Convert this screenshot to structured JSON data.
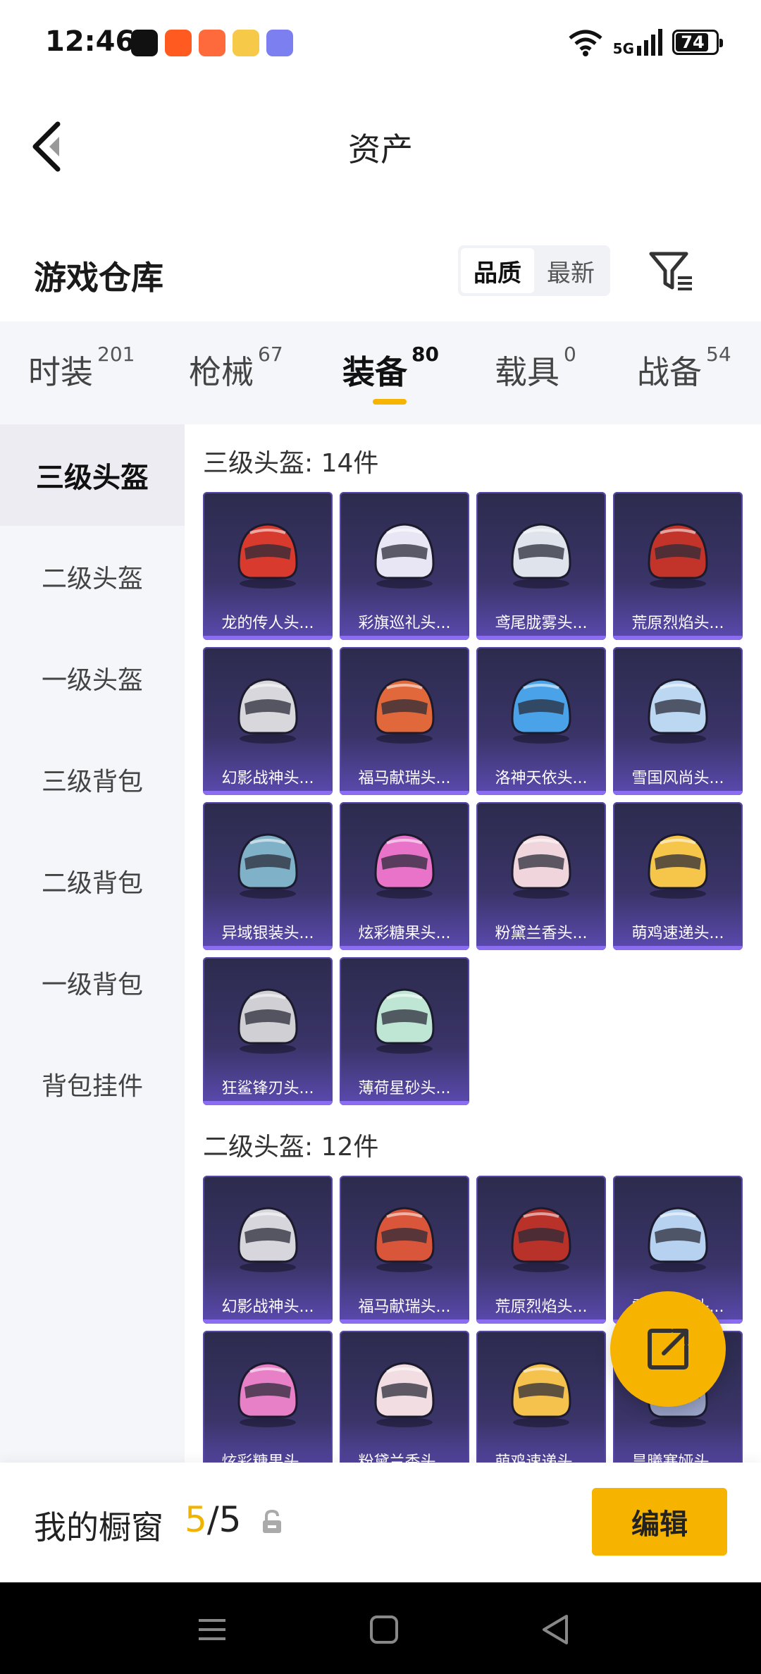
{
  "status_bar": {
    "time": "12:46",
    "network": "5G",
    "battery": "74"
  },
  "nav": {
    "title": "资产"
  },
  "warehouse": {
    "title": "游戏仓库",
    "sort_options": [
      "品质",
      "最新"
    ],
    "active_sort": "品质"
  },
  "categories": [
    {
      "label": "时装",
      "count": "201"
    },
    {
      "label": "枪械",
      "count": "67"
    },
    {
      "label": "装备",
      "count": "80",
      "active": true
    },
    {
      "label": "载具",
      "count": "0"
    },
    {
      "label": "战备",
      "count": "54"
    }
  ],
  "side_nav": [
    "三级头盔",
    "二级头盔",
    "一级头盔",
    "三级背包",
    "二级背包",
    "一级背包",
    "背包挂件"
  ],
  "sections": [
    {
      "title": "三级头盔: 14件",
      "items": [
        {
          "name": "龙的传人头...",
          "color": "#d83a2e"
        },
        {
          "name": "彩旗巡礼头...",
          "color": "#e8e6f4"
        },
        {
          "name": "鸢尾胧雾头...",
          "color": "#dfe3ec"
        },
        {
          "name": "荒原烈焰头...",
          "color": "#c2342a"
        },
        {
          "name": "幻影战神头...",
          "color": "#d8d8dc"
        },
        {
          "name": "福马献瑞头...",
          "color": "#e0683a"
        },
        {
          "name": "洛神天依头...",
          "color": "#4aa3e8"
        },
        {
          "name": "雪国风尚头...",
          "color": "#bcd7f2"
        },
        {
          "name": "异域银装头...",
          "color": "#7fb2c8"
        },
        {
          "name": "炫彩糖果头...",
          "color": "#e873c9"
        },
        {
          "name": "粉黛兰香头...",
          "color": "#f0d6dc"
        },
        {
          "name": "萌鸡速递头...",
          "color": "#f6c64a"
        },
        {
          "name": "狂鲨锋刃头...",
          "color": "#cfcfd4"
        },
        {
          "name": "薄荷星砂头...",
          "color": "#bfe6d4"
        }
      ]
    },
    {
      "title": "二级头盔: 12件",
      "items": [
        {
          "name": "幻影战神头...",
          "color": "#d6d6dc"
        },
        {
          "name": "福马献瑞头...",
          "color": "#d9563a"
        },
        {
          "name": "荒原烈焰头...",
          "color": "#b8322a"
        },
        {
          "name": "雪国风尚头...",
          "color": "#b7d2f0"
        },
        {
          "name": "炫彩糖果头...",
          "color": "#e880c8"
        },
        {
          "name": "粉黛兰香头...",
          "color": "#f1dde2"
        },
        {
          "name": "萌鸡速递头...",
          "color": "#f5c24e"
        },
        {
          "name": "昙曦寒娅头...",
          "color": "#9aa4c8"
        }
      ]
    }
  ],
  "showcase": {
    "label": "我的橱窗",
    "current": "5",
    "total": "/5",
    "edit_label": "编辑"
  }
}
